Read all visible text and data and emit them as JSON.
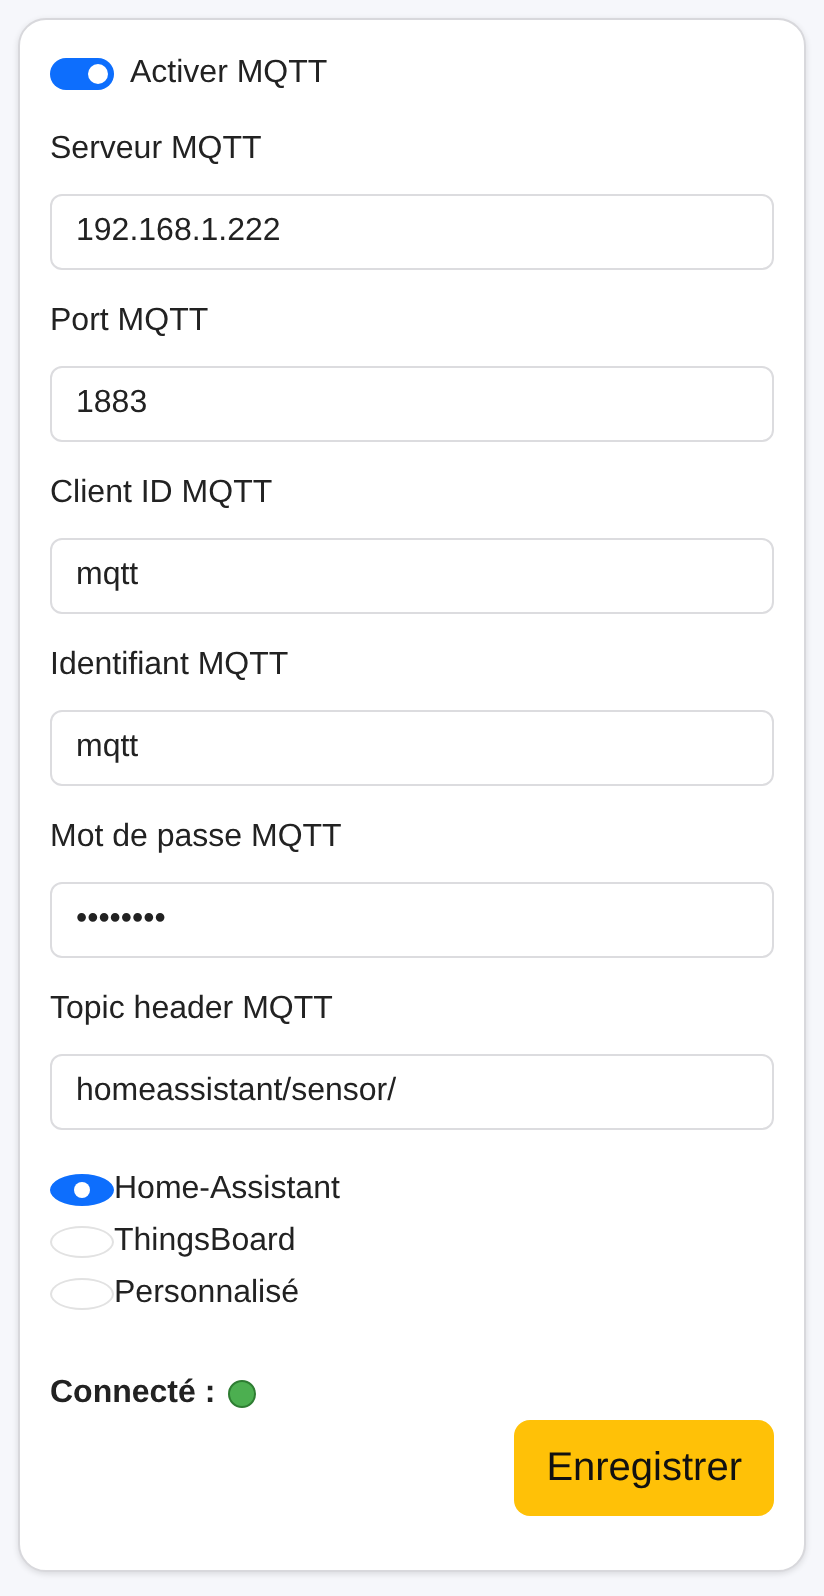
{
  "enable": {
    "label": "Activer MQTT",
    "on": true
  },
  "fields": [
    {
      "label": "Serveur MQTT",
      "value": "192.168.1.222"
    },
    {
      "label": "Port MQTT",
      "value": "1883"
    },
    {
      "label": "Client ID MQTT",
      "value": "mqtt"
    },
    {
      "label": "Identifiant MQTT",
      "value": "mqtt"
    },
    {
      "label": "Mot de passe MQTT",
      "value": "••••••••"
    },
    {
      "label": "Topic header MQTT",
      "value": "homeassistant/sensor/"
    }
  ],
  "platforms": [
    {
      "label": "Home-Assistant",
      "selected": true
    },
    {
      "label": "ThingsBoard",
      "selected": false
    },
    {
      "label": "Personnalisé",
      "selected": false
    }
  ],
  "status": {
    "label": "Connecté :",
    "connected": true
  },
  "save_button": "Enregistrer"
}
